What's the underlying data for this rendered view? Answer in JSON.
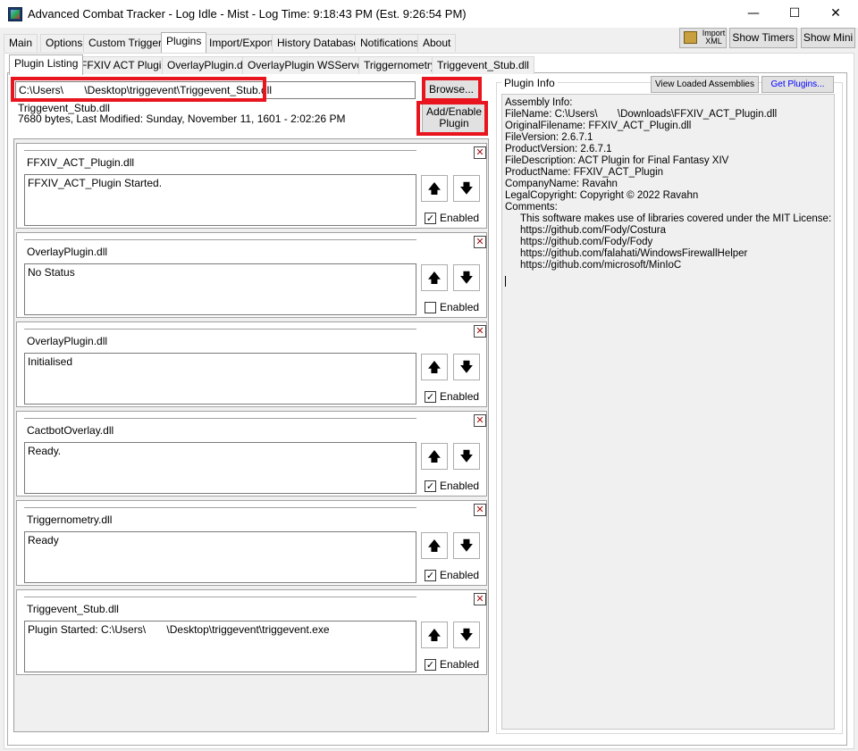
{
  "window": {
    "title": "Advanced Combat Tracker - Log Idle - Mist - Log Time: 9:18:43 PM (Est. 9:26:54 PM)",
    "minimize_glyph": "—",
    "maximize_glyph": "☐",
    "close_glyph": "✕"
  },
  "main_tabs": [
    "Main",
    "Options",
    "Custom Triggers",
    "Plugins",
    "Import/Export",
    "History Database",
    "Notifications",
    "About"
  ],
  "toolbar": {
    "import_xml_label_1": "Import",
    "import_xml_label_2": "XML",
    "show_timers": "Show Timers",
    "show_mini": "Show Mini"
  },
  "sub_tabs": [
    "Plugin Listing",
    "FFXIV ACT Plugin",
    "OverlayPlugin.dll",
    "OverlayPlugin WSServer",
    "Triggernometry",
    "Triggevent_Stub.dll"
  ],
  "file_select": {
    "path": "C:\\Users\\       \\Desktop\\triggevent\\Triggevent_Stub.dll",
    "browse_label": "Browse...",
    "add_enable_label_1": "Add/Enable",
    "add_enable_label_2": "Plugin",
    "file_name": "Triggevent_Stub.dll",
    "file_meta": "7680 bytes, Last Modified: Sunday, November 11, 1601 - 2:02:26 PM"
  },
  "plugins": [
    {
      "name": "FFXIV_ACT_Plugin.dll",
      "status": "FFXIV_ACT_Plugin Started.",
      "enabled": true,
      "enabled_label": "Enabled"
    },
    {
      "name": "OverlayPlugin.dll",
      "status": "No Status",
      "enabled": false,
      "enabled_label": "Enabled"
    },
    {
      "name": "OverlayPlugin.dll",
      "status": "Initialised",
      "enabled": true,
      "enabled_label": "Enabled"
    },
    {
      "name": "CactbotOverlay.dll",
      "status": "Ready.",
      "enabled": true,
      "enabled_label": "Enabled"
    },
    {
      "name": "Triggernometry.dll",
      "status": "Ready",
      "enabled": true,
      "enabled_label": "Enabled"
    },
    {
      "name": "Triggevent_Stub.dll",
      "status": "Plugin Started: C:\\Users\\       \\Desktop\\triggevent\\triggevent.exe",
      "enabled": true,
      "enabled_label": "Enabled"
    }
  ],
  "plugin_info": {
    "legend": "Plugin Info",
    "view_loaded_label": "View Loaded Assemblies",
    "get_plugins_label": "Get Plugins...",
    "lines": [
      "Assembly Info:",
      "FileName: C:\\Users\\       \\Downloads\\FFXIV_ACT_Plugin.dll",
      "OriginalFilename: FFXIV_ACT_Plugin.dll",
      "FileVersion: 2.6.7.1",
      "ProductVersion: 2.6.7.1",
      "FileDescription: ACT Plugin for Final Fantasy XIV",
      "ProductName: FFXIV_ACT_Plugin",
      "CompanyName: Ravahn",
      "LegalCopyright: Copyright © 2022 Ravahn",
      "Comments:"
    ],
    "comment_lines": [
      "This software makes use of libraries covered under the MIT License:",
      "https://github.com/Fody/Costura",
      "https://github.com/Fody/Fody",
      "https://github.com/falahati/WindowsFirewallHelper",
      "https://github.com/microsoft/MinIoC"
    ]
  },
  "icons": {
    "up_arrow": "🡅",
    "down_arrow": "🡇",
    "remove": "✕",
    "check": "✓"
  },
  "colors": {
    "highlight_red": "#e8141e",
    "link_blue": "#0000ff"
  }
}
